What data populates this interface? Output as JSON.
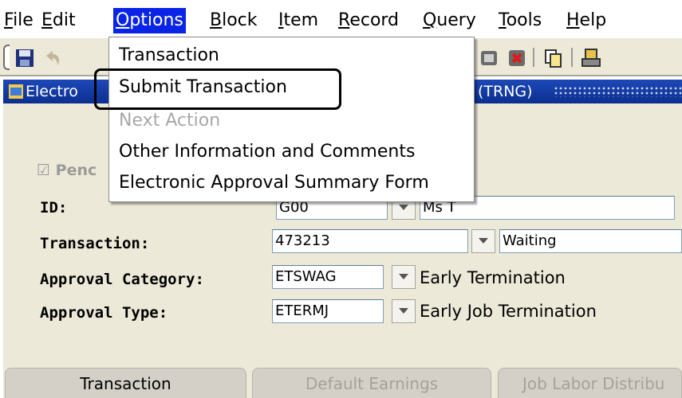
{
  "menubar": {
    "items": [
      {
        "label": "File",
        "ul": "F",
        "rest": "ile"
      },
      {
        "label": "Edit",
        "ul": "E",
        "rest": "dit"
      },
      {
        "label": "Options",
        "ul": "O",
        "rest": "ptions"
      },
      {
        "label": "Block",
        "ul": "B",
        "rest": "lock"
      },
      {
        "label": "Item",
        "ul": "I",
        "rest": "tem"
      },
      {
        "label": "Record",
        "ul": "R",
        "rest": "ecord"
      },
      {
        "label": "Query",
        "ul": "Q",
        "rest": "uery"
      },
      {
        "label": "Tools",
        "ul": "T",
        "rest": "ools"
      },
      {
        "label": "Help",
        "ul": "H",
        "rest": "elp"
      }
    ],
    "active": "Options"
  },
  "window": {
    "title_left": "Electro",
    "title_right": "(TRNG)"
  },
  "options_menu": {
    "items": [
      {
        "label": "Transaction",
        "enabled": true
      },
      {
        "label": "Submit Transaction",
        "enabled": true,
        "highlighted": true
      },
      {
        "label": "Next Action",
        "enabled": false
      },
      {
        "label": "Other Information and Comments",
        "enabled": true
      },
      {
        "label": "Electronic Approval Summary Form",
        "enabled": true
      }
    ]
  },
  "form": {
    "pending_label": "Penc",
    "id_label": "ID:",
    "id_value": "G00",
    "id_name": "Ms T",
    "transaction_label": "Transaction:",
    "transaction_value": "473213",
    "transaction_status": "Waiting",
    "approval_category_label": "Approval Category:",
    "approval_category_code": "ETSWAG",
    "approval_category_desc": "Early Termination",
    "approval_type_label": "Approval Type:",
    "approval_type_code": "ETERMJ",
    "approval_type_desc": "Early Job Termination"
  },
  "tabs": [
    {
      "label": "Transaction",
      "enabled": true
    },
    {
      "label": "Default Earnings",
      "enabled": false
    },
    {
      "label": "Job Labor Distribu",
      "enabled": false
    }
  ],
  "colors": {
    "menu_active": "#0a24e6",
    "title_bar": "#0c2f8f",
    "form_bg": "#ece9d8"
  }
}
